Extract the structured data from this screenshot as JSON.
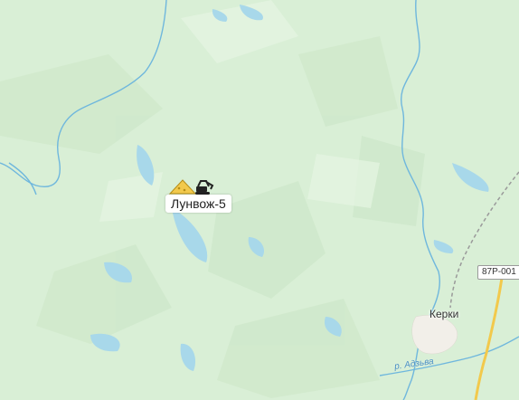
{
  "map": {
    "background_color": "#d9efd6",
    "water_color": "#a8d8ea",
    "river_color": "#6fb7dd",
    "road_color": "#f2c94c"
  },
  "poi": {
    "label": "Лунвож-5",
    "icon": "mining-excavator-icon"
  },
  "settlement": {
    "label": "Керки"
  },
  "road": {
    "label": "87Р-001"
  },
  "river": {
    "label": "р. Адзьва"
  }
}
